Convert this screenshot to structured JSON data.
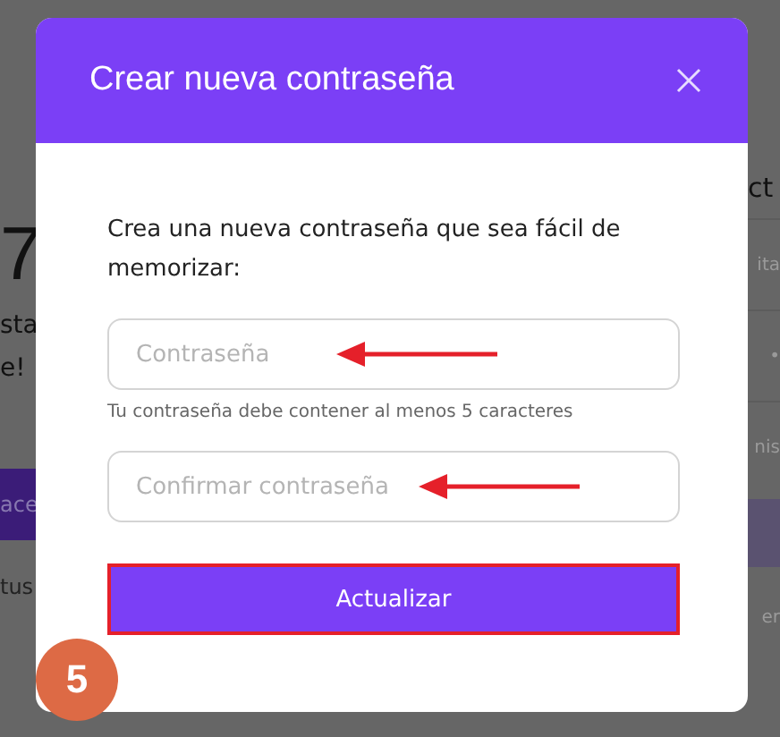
{
  "background": {
    "left": [
      {
        "kind": "big",
        "text": "7"
      },
      {
        "kind": "heading",
        "text": "sta"
      },
      {
        "kind": "heading",
        "text": "e!"
      },
      {
        "kind": "bar",
        "text": "ace"
      },
      {
        "kind": "small",
        "text": "tus"
      }
    ],
    "right": [
      {
        "kind": "heading",
        "text": "ct"
      },
      {
        "kind": "row",
        "text": "ita"
      },
      {
        "kind": "row",
        "text": "•"
      },
      {
        "kind": "row",
        "text": "nis"
      },
      {
        "kind": "bar"
      },
      {
        "kind": "small",
        "text": "er"
      }
    ]
  },
  "dialog": {
    "title": "Crear nueva contraseña",
    "description": "Crea una nueva contraseña que sea fácil de memorizar:",
    "fields": [
      {
        "placeholder": "Contraseña",
        "hint": "Tu contraseña debe contener al menos 5 caracteres",
        "arrow": true
      },
      {
        "placeholder": "Confirmar contraseña",
        "arrow": true
      }
    ],
    "button": {
      "label": "Actualizar",
      "highlighted": true
    }
  },
  "step_badge": "5"
}
